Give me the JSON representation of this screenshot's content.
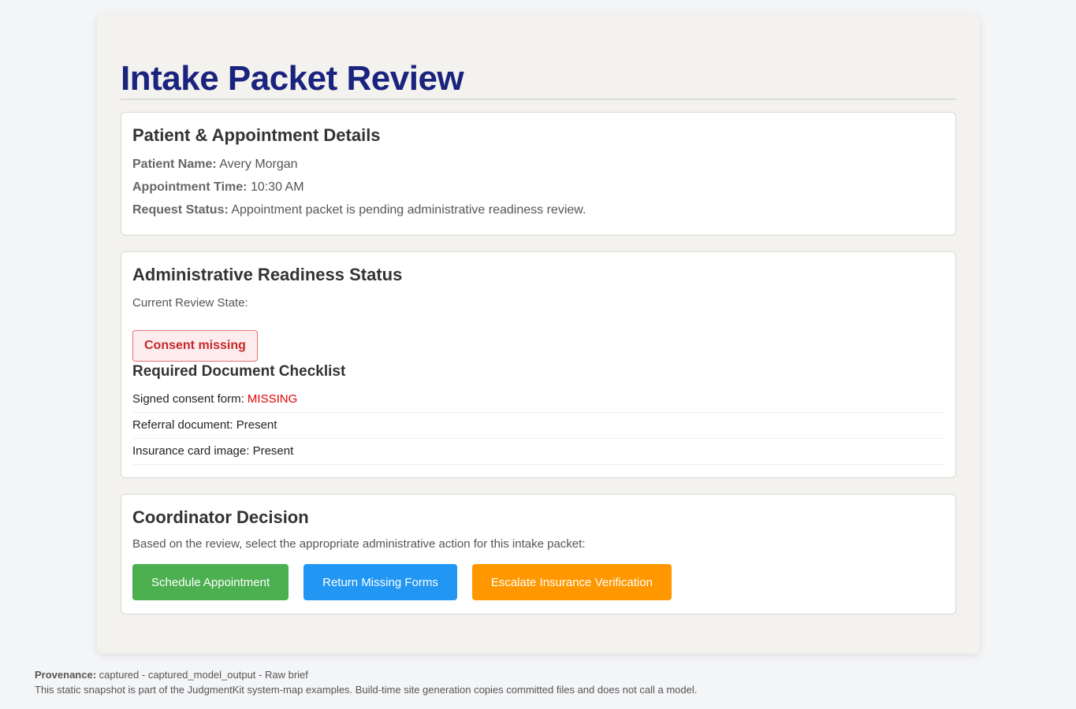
{
  "page": {
    "title": "Intake Packet Review"
  },
  "patient_card": {
    "heading": "Patient & Appointment Details",
    "patient_name_label": "Patient Name:",
    "patient_name": "Avery Morgan",
    "appointment_time_label": "Appointment Time:",
    "appointment_time": "10:30 AM",
    "request_status_label": "Request Status:",
    "request_status": "Appointment packet is pending administrative readiness review."
  },
  "readiness_card": {
    "heading": "Administrative Readiness Status",
    "current_state_label": "Current Review State:",
    "state_badge": "Consent missing",
    "checklist_heading": "Required Document Checklist",
    "checklist": [
      {
        "label": "Signed consent form:",
        "status": "MISSING"
      },
      {
        "label": "Referral document:",
        "status": "Present"
      },
      {
        "label": "Insurance card image:",
        "status": "Present"
      }
    ]
  },
  "decision_card": {
    "heading": "Coordinator Decision",
    "instructions": "Based on the review, select the appropriate administrative action for this intake packet:",
    "buttons": {
      "schedule": "Schedule Appointment",
      "return_forms": "Return Missing Forms",
      "escalate": "Escalate Insurance Verification"
    }
  },
  "footer": {
    "provenance_label": "Provenance:",
    "provenance_value": "captured - captured_model_output - Raw brief",
    "note": "This static snapshot is part of the JudgmentKit system-map examples. Build-time site generation copies committed files and does not call a model."
  },
  "colors": {
    "title": "#1a237e",
    "badge_text": "#c62828",
    "missing": "#e00000",
    "button_green": "#4caf50",
    "button_blue": "#2196f3",
    "button_orange": "#ff9800"
  }
}
